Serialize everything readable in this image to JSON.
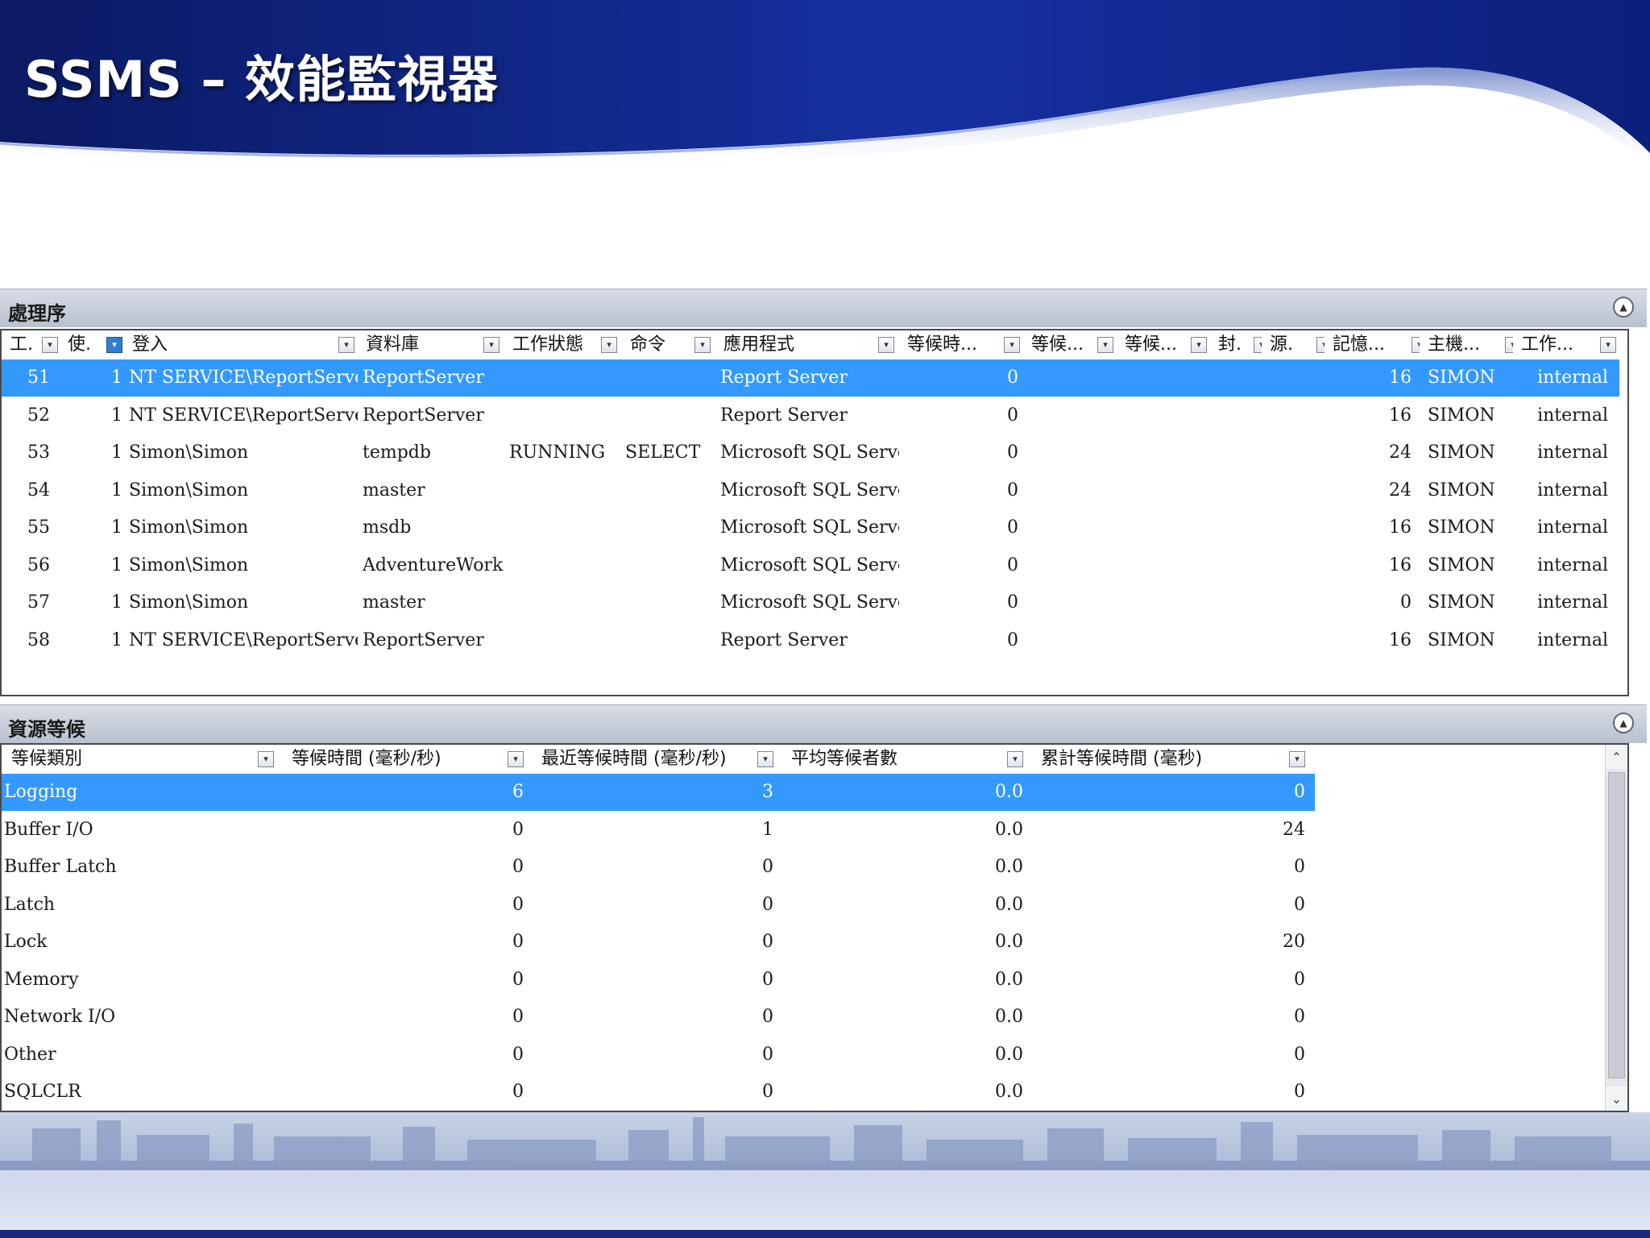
{
  "slide": {
    "title": "SSMS – 效能監視器"
  },
  "processes": {
    "title": "處理序",
    "columns": [
      "工.",
      "使.",
      "登入",
      "資料庫",
      "工作狀態",
      "命令",
      "應用程式",
      "等候時...",
      "等候...",
      "等候...",
      "封.",
      "源.",
      "記憶...",
      "主機...",
      "工作..."
    ],
    "rows": [
      {
        "id": "51",
        "user": "1",
        "login": "NT SERVICE\\ReportServer",
        "db": "ReportServer",
        "state": "",
        "cmd": "",
        "app": "Report Server",
        "wait": "0",
        "mem": "16",
        "host": "SIMON",
        "group": "internal",
        "selected": true
      },
      {
        "id": "52",
        "user": "1",
        "login": "NT SERVICE\\ReportServer",
        "db": "ReportServer",
        "state": "",
        "cmd": "",
        "app": "Report Server",
        "wait": "0",
        "mem": "16",
        "host": "SIMON",
        "group": "internal",
        "selected": false
      },
      {
        "id": "53",
        "user": "1",
        "login": "Simon\\Simon",
        "db": "tempdb",
        "state": "RUNNING",
        "cmd": "SELECT",
        "app": "Microsoft SQL Server...",
        "wait": "0",
        "mem": "24",
        "host": "SIMON",
        "group": "internal",
        "selected": false
      },
      {
        "id": "54",
        "user": "1",
        "login": "Simon\\Simon",
        "db": "master",
        "state": "",
        "cmd": "",
        "app": "Microsoft SQL Server...",
        "wait": "0",
        "mem": "24",
        "host": "SIMON",
        "group": "internal",
        "selected": false
      },
      {
        "id": "55",
        "user": "1",
        "login": "Simon\\Simon",
        "db": "msdb",
        "state": "",
        "cmd": "",
        "app": "Microsoft SQL Server...",
        "wait": "0",
        "mem": "16",
        "host": "SIMON",
        "group": "internal",
        "selected": false
      },
      {
        "id": "56",
        "user": "1",
        "login": "Simon\\Simon",
        "db": "AdventureWork...",
        "state": "",
        "cmd": "",
        "app": "Microsoft SQL Server...",
        "wait": "0",
        "mem": "16",
        "host": "SIMON",
        "group": "internal",
        "selected": false
      },
      {
        "id": "57",
        "user": "1",
        "login": "Simon\\Simon",
        "db": "master",
        "state": "",
        "cmd": "",
        "app": "Microsoft SQL Server...",
        "wait": "0",
        "mem": "0",
        "host": "SIMON",
        "group": "internal",
        "selected": false
      },
      {
        "id": "58",
        "user": "1",
        "login": "NT SERVICE\\ReportServer",
        "db": "ReportServer",
        "state": "",
        "cmd": "",
        "app": "Report Server",
        "wait": "0",
        "mem": "16",
        "host": "SIMON",
        "group": "internal",
        "selected": false
      }
    ]
  },
  "waits": {
    "title": "資源等候",
    "columns": [
      "等候類別",
      "等候時間 (毫秒/秒)",
      "最近等候時間 (毫秒/秒)",
      "平均等候者數",
      "累計等候時間 (毫秒)"
    ],
    "rows": [
      {
        "category": "Logging",
        "wait": "6",
        "recent": "3",
        "avg": "0.0",
        "cumulative": "0",
        "selected": true
      },
      {
        "category": "Buffer I/O",
        "wait": "0",
        "recent": "1",
        "avg": "0.0",
        "cumulative": "24",
        "selected": false
      },
      {
        "category": "Buffer Latch",
        "wait": "0",
        "recent": "0",
        "avg": "0.0",
        "cumulative": "0",
        "selected": false
      },
      {
        "category": "Latch",
        "wait": "0",
        "recent": "0",
        "avg": "0.0",
        "cumulative": "0",
        "selected": false
      },
      {
        "category": "Lock",
        "wait": "0",
        "recent": "0",
        "avg": "0.0",
        "cumulative": "20",
        "selected": false
      },
      {
        "category": "Memory",
        "wait": "0",
        "recent": "0",
        "avg": "0.0",
        "cumulative": "0",
        "selected": false
      },
      {
        "category": "Network I/O",
        "wait": "0",
        "recent": "0",
        "avg": "0.0",
        "cumulative": "0",
        "selected": false
      },
      {
        "category": "Other",
        "wait": "0",
        "recent": "0",
        "avg": "0.0",
        "cumulative": "0",
        "selected": false
      },
      {
        "category": "SQLCLR",
        "wait": "0",
        "recent": "0",
        "avg": "0.0",
        "cumulative": "0",
        "selected": false
      }
    ]
  },
  "colors": {
    "banner_dark": "#0a1f6e",
    "banner_mid": "#1d3fa3",
    "selection": "#3399ff",
    "panel_header": "#c2c9d6"
  },
  "icons": {
    "collapse": "collapse-up-icon",
    "filter": "filter-dropdown-icon",
    "scroll_up": "chevron-up-icon",
    "scroll_down": "chevron-down-icon"
  }
}
